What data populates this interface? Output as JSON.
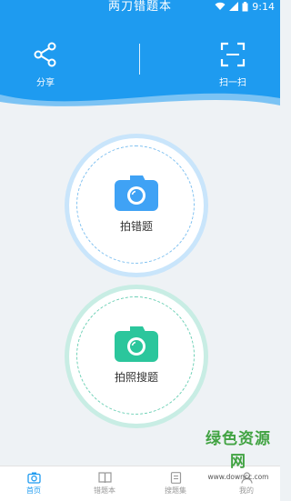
{
  "app": {
    "title": "两刀错题本"
  },
  "status_bar": {
    "time": "9:14"
  },
  "header": {
    "share_label": "分享",
    "scan_label": "扫一扫"
  },
  "main": {
    "wrong_label": "拍错题",
    "photo_search_label": "拍照搜题"
  },
  "tabs": [
    {
      "label": "首页",
      "icon": "camera-icon",
      "active": true
    },
    {
      "label": "错题本",
      "icon": "book-icon",
      "active": false
    },
    {
      "label": "搜题集",
      "icon": "document-icon",
      "active": false
    },
    {
      "label": "我的",
      "icon": "user-icon",
      "active": false
    }
  ],
  "watermark": {
    "line1": "绿色资源网",
    "line2": "www.downcc.com"
  },
  "colors": {
    "primary": "#1e9bf0",
    "camera_blue": "#3fa2f5",
    "camera_green": "#2bc69c"
  }
}
